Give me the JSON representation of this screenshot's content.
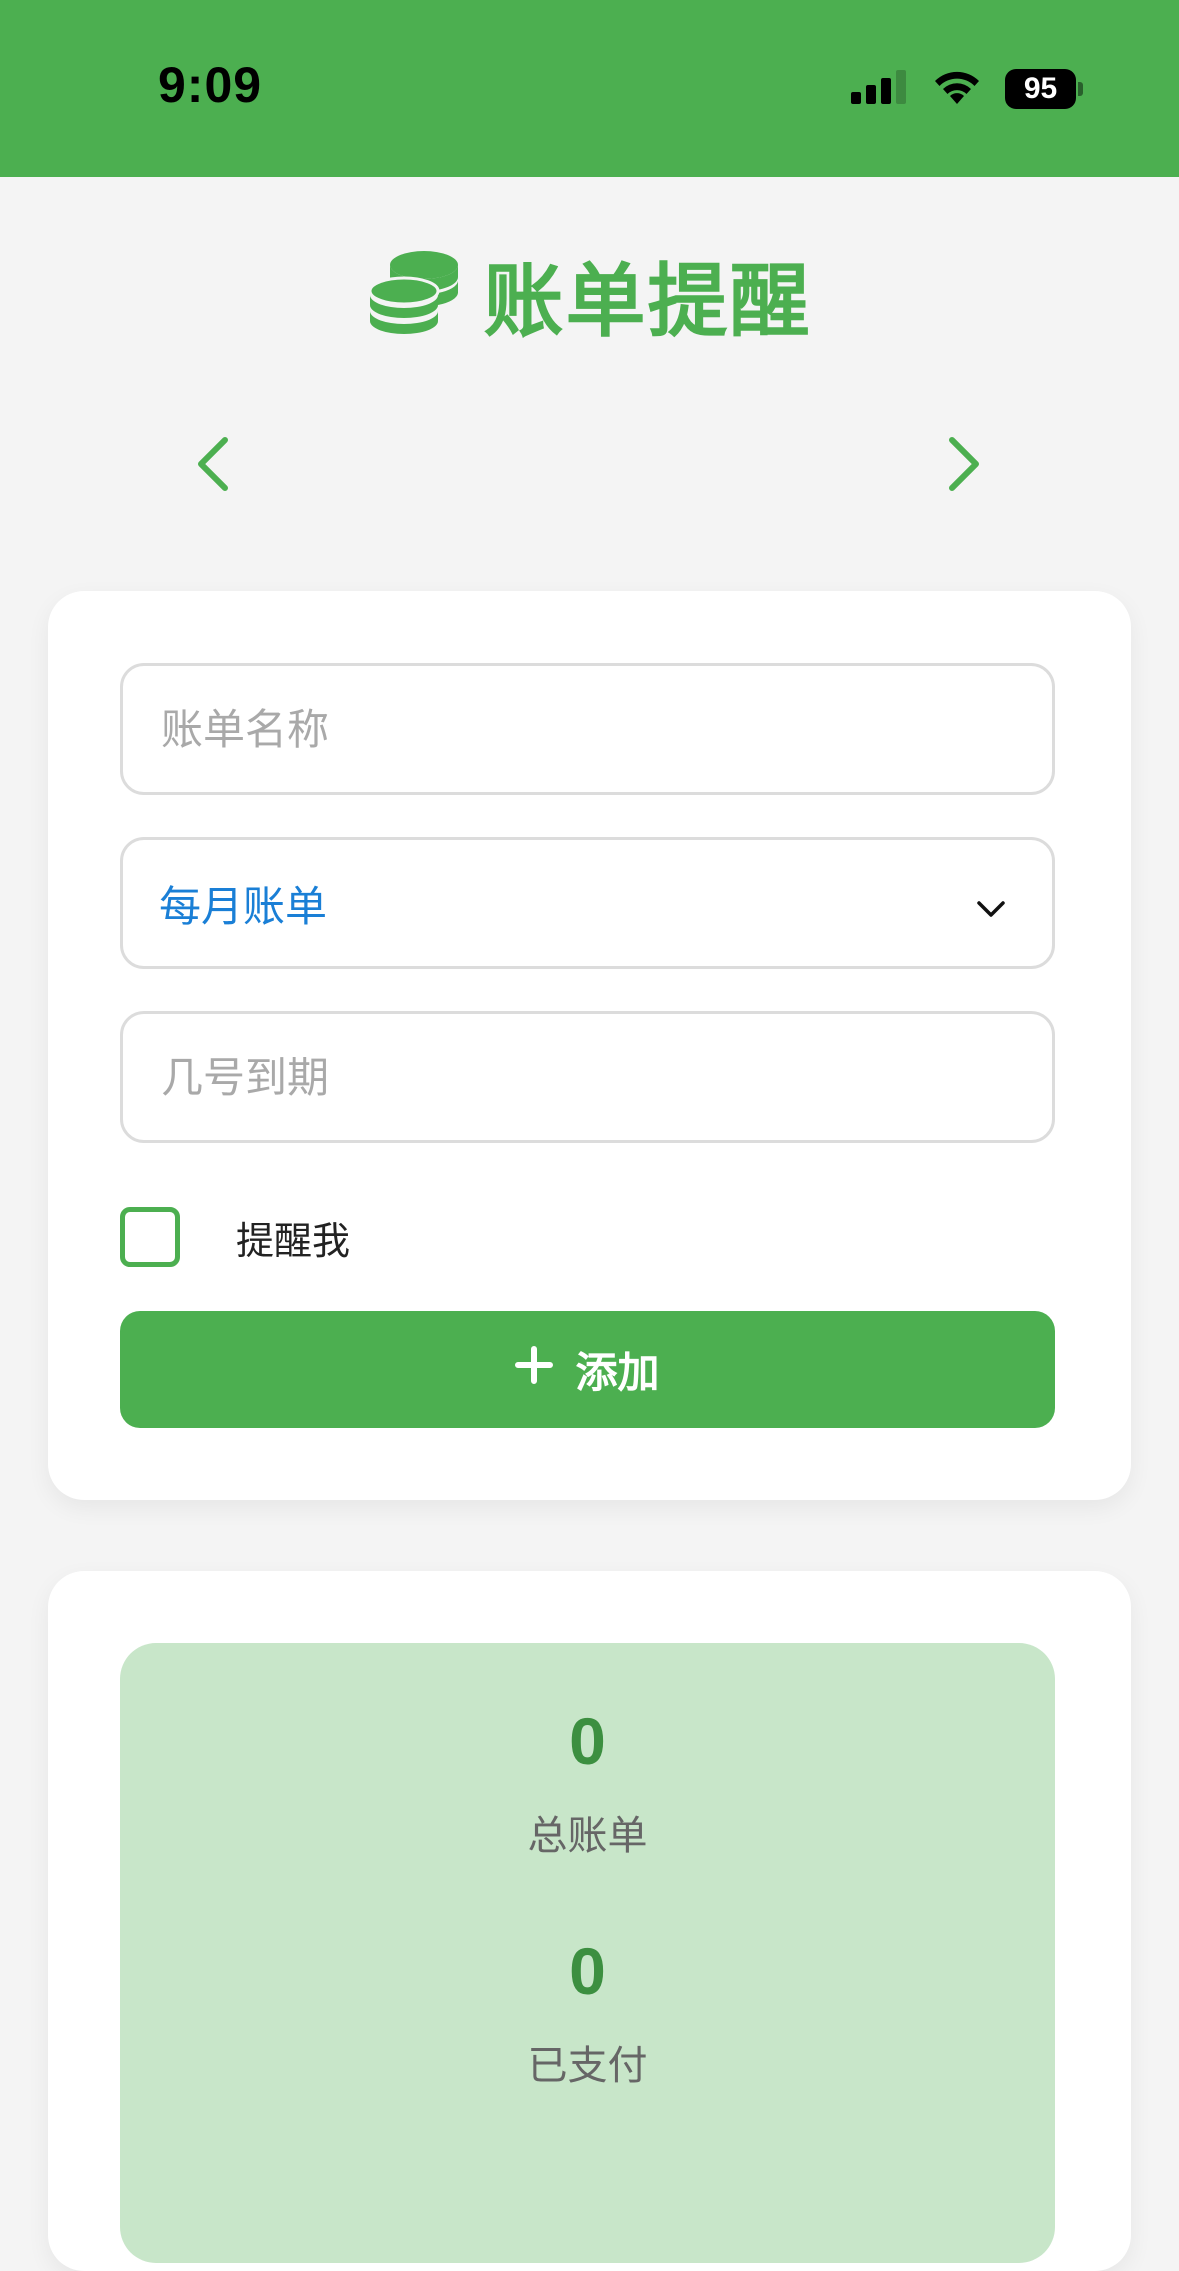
{
  "status_bar": {
    "time": "9:09",
    "battery": "95",
    "icons": [
      "cellular-signal-icon",
      "wifi-icon",
      "battery-icon"
    ],
    "background": "#4caf50"
  },
  "header": {
    "icon": "coins-icon",
    "title": "账单提醒",
    "color": "#4caf50"
  },
  "navigation": {
    "prev_icon": "chevron-left-icon",
    "next_icon": "chevron-right-icon"
  },
  "form": {
    "name_placeholder": "账单名称",
    "name_value": "",
    "type_selected": "每月账单",
    "type_icon": "chevron-down-icon",
    "day_placeholder": "几号到期",
    "day_value": "",
    "remind_label": "提醒我",
    "remind_checked": false,
    "add_button_label": "添加",
    "add_button_icon": "plus-icon"
  },
  "stats": {
    "total_value": "0",
    "total_label": "总账单",
    "paid_value": "0",
    "paid_label": "已支付"
  },
  "colors": {
    "accent": "#4caf50",
    "select_text": "#1a7fd6",
    "stats_background": "#c8e6c9",
    "stat_value": "#3c8f40"
  }
}
